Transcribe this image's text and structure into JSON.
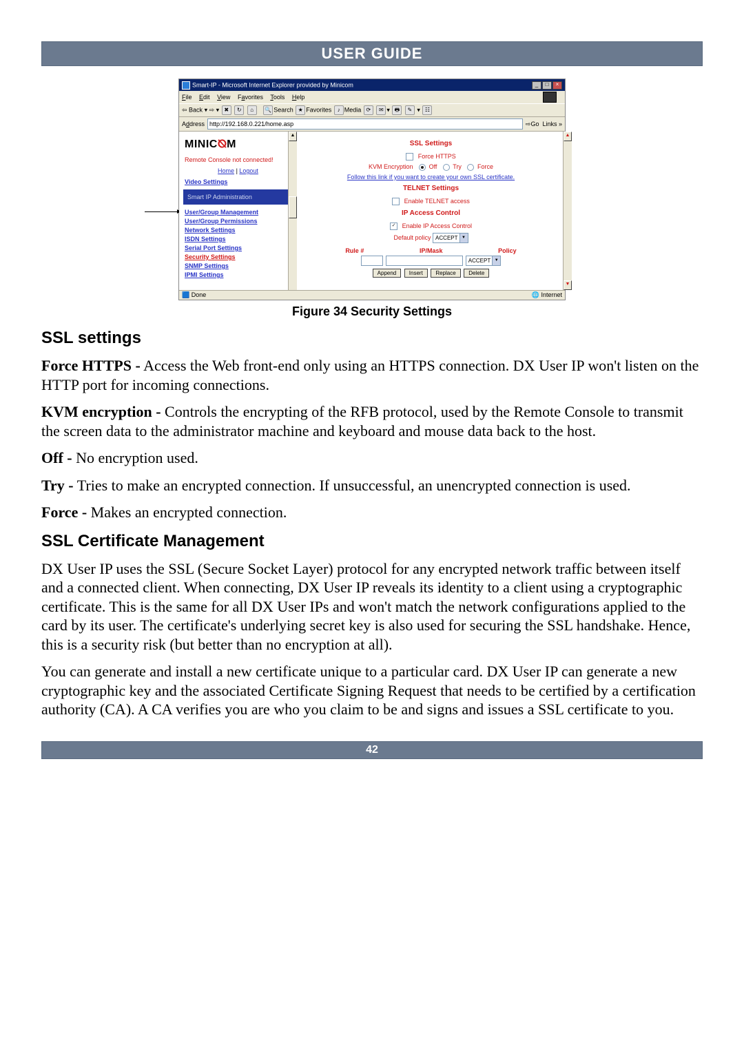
{
  "header": {
    "title": "USER GUIDE"
  },
  "screenshot": {
    "window_title": "Smart-IP - Microsoft Internet Explorer provided by Minicom",
    "menus": {
      "file": "File",
      "edit": "Edit",
      "view": "View",
      "favorites": "Favorites",
      "tools": "Tools",
      "help": "Help"
    },
    "toolbar": {
      "back": "Back",
      "search": "Search",
      "favorites": "Favorites",
      "media": "Media"
    },
    "address_label": "Address",
    "address_value": "http://192.168.0.221/home.asp",
    "go": "Go",
    "links": "Links",
    "sidebar": {
      "logo_left": "MINIC",
      "logo_right": "M",
      "status": "Remote Console not connected!",
      "home": "Home",
      "logout": "Logout",
      "items": [
        "Video Settings",
        "Smart IP Administration",
        "User/Group Management",
        "User/Group Permissions",
        "Network Settings",
        "ISDN Settings",
        "Serial Port Settings",
        "Security Settings",
        "SNMP Settings",
        "IPMI Settings"
      ]
    },
    "main": {
      "ssl_title": "SSL Settings",
      "force_https": "Force HTTPS",
      "kvm_label": "KVM Encryption",
      "kvm_off": "Off",
      "kvm_try": "Try",
      "kvm_force": "Force",
      "cert_link": "Follow this link if you want to create your own SSL certificate.",
      "telnet_title": "TELNET Settings",
      "telnet_enable": "Enable TELNET access",
      "ipac_title": "IP Access Control",
      "ipac_enable": "Enable IP Access Control",
      "default_policy_label": "Default policy",
      "default_policy_value": "ACCEPT",
      "cols": {
        "rule": "Rule #",
        "ipmask": "IP/Mask",
        "policy": "Policy"
      },
      "row_policy": "ACCEPT",
      "buttons": {
        "append": "Append",
        "insert": "Insert",
        "replace": "Replace",
        "delete": "Delete"
      }
    },
    "status_done": "Done",
    "status_zone": "Internet"
  },
  "caption": "Figure 34 Security Settings",
  "sections": {
    "ssl_settings": "SSL settings",
    "ssl_cert_mgmt": "SSL Certificate Management"
  },
  "paragraphs": {
    "force_https_term": "Force HTTPS -",
    "force_https_text": " Access the Web front-end only using an HTTPS connection. DX User IP won't listen on the HTTP port for incoming connections.",
    "kvm_term": "KVM encryption -",
    "kvm_text": " Controls the encrypting of the RFB protocol, used by the Remote Console to transmit the screen data to the administrator machine and keyboard and mouse data back to the host.",
    "off_term": "Off -",
    "off_text": " No encryption used.",
    "try_term": "Try -",
    "try_text": " Tries to make an encrypted connection. If unsuccessful, an unencrypted connection is used.",
    "force_term": "Force -",
    "force_text": " Makes an encrypted connection.",
    "cert1": "DX User IP uses the SSL (Secure Socket Layer) protocol for any encrypted network traffic between itself and a connected client. When connecting, DX User IP reveals its identity to a client using a cryptographic certificate. This is the same for all DX User IPs and won't match the network configurations applied to the card by its user. The certificate's underlying secret key is also used for securing the SSL handshake. Hence, this is a security risk (but better than no encryption at all).",
    "cert2": "You can generate and install a new certificate unique to a particular card. DX User IP can generate a new cryptographic key and the associated Certificate Signing Request that needs to be certified by a certification authority (CA). A CA verifies you are who you claim to be and signs and issues a SSL certificate to you."
  },
  "footer": {
    "page": "42"
  }
}
